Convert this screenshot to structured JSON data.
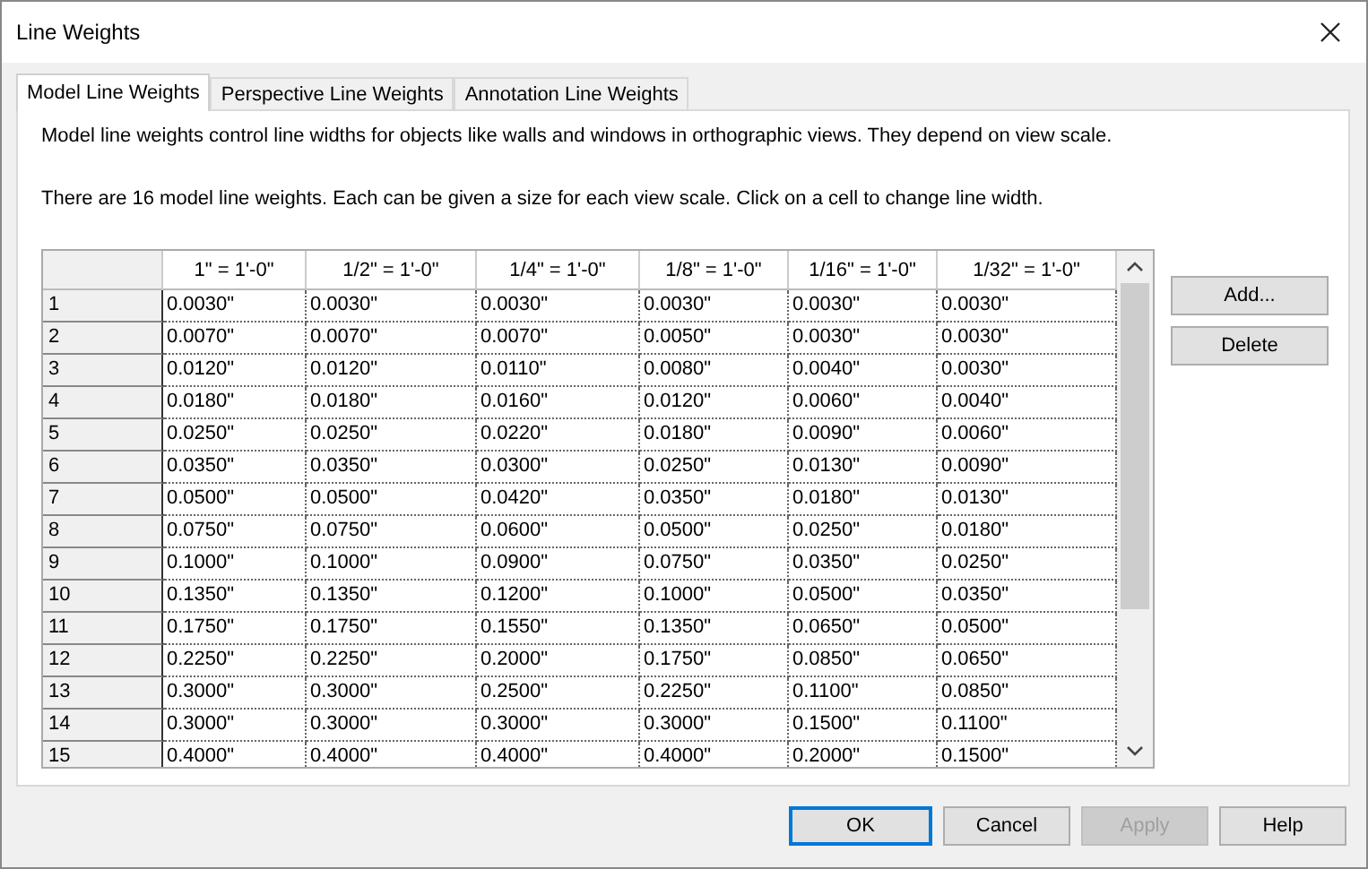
{
  "window": {
    "title": "Line Weights"
  },
  "tabs": [
    {
      "label": "Model Line Weights",
      "selected": true
    },
    {
      "label": "Perspective Line Weights",
      "selected": false
    },
    {
      "label": "Annotation Line Weights",
      "selected": false
    }
  ],
  "description": [
    "Model line weights control line widths for objects like walls and windows in orthographic views. They depend on view scale.",
    "There are 16 model line weights. Each can be given a size for each view scale. Click on a cell to change line width."
  ],
  "table": {
    "columns": [
      "1\" = 1'-0\"",
      "1/2\" = 1'-0\"",
      "1/4\" = 1'-0\"",
      "1/8\" = 1'-0\"",
      "1/16\" = 1'-0\"",
      "1/32\" = 1'-0\""
    ],
    "rows": [
      {
        "label": "1",
        "cells": [
          "0.0030\"",
          "0.0030\"",
          "0.0030\"",
          "0.0030\"",
          "0.0030\"",
          "0.0030\""
        ]
      },
      {
        "label": "2",
        "cells": [
          "0.0070\"",
          "0.0070\"",
          "0.0070\"",
          "0.0050\"",
          "0.0030\"",
          "0.0030\""
        ]
      },
      {
        "label": "3",
        "cells": [
          "0.0120\"",
          "0.0120\"",
          "0.0110\"",
          "0.0080\"",
          "0.0040\"",
          "0.0030\""
        ]
      },
      {
        "label": "4",
        "cells": [
          "0.0180\"",
          "0.0180\"",
          "0.0160\"",
          "0.0120\"",
          "0.0060\"",
          "0.0040\""
        ]
      },
      {
        "label": "5",
        "cells": [
          "0.0250\"",
          "0.0250\"",
          "0.0220\"",
          "0.0180\"",
          "0.0090\"",
          "0.0060\""
        ]
      },
      {
        "label": "6",
        "cells": [
          "0.0350\"",
          "0.0350\"",
          "0.0300\"",
          "0.0250\"",
          "0.0130\"",
          "0.0090\""
        ]
      },
      {
        "label": "7",
        "cells": [
          "0.0500\"",
          "0.0500\"",
          "0.0420\"",
          "0.0350\"",
          "0.0180\"",
          "0.0130\""
        ]
      },
      {
        "label": "8",
        "cells": [
          "0.0750\"",
          "0.0750\"",
          "0.0600\"",
          "0.0500\"",
          "0.0250\"",
          "0.0180\""
        ]
      },
      {
        "label": "9",
        "cells": [
          "0.1000\"",
          "0.1000\"",
          "0.0900\"",
          "0.0750\"",
          "0.0350\"",
          "0.0250\""
        ]
      },
      {
        "label": "10",
        "cells": [
          "0.1350\"",
          "0.1350\"",
          "0.1200\"",
          "0.1000\"",
          "0.0500\"",
          "0.0350\""
        ]
      },
      {
        "label": "11",
        "cells": [
          "0.1750\"",
          "0.1750\"",
          "0.1550\"",
          "0.1350\"",
          "0.0650\"",
          "0.0500\""
        ]
      },
      {
        "label": "12",
        "cells": [
          "0.2250\"",
          "0.2250\"",
          "0.2000\"",
          "0.1750\"",
          "0.0850\"",
          "0.0650\""
        ]
      },
      {
        "label": "13",
        "cells": [
          "0.3000\"",
          "0.3000\"",
          "0.2500\"",
          "0.2250\"",
          "0.1100\"",
          "0.0850\""
        ]
      },
      {
        "label": "14",
        "cells": [
          "0.3000\"",
          "0.3000\"",
          "0.3000\"",
          "0.3000\"",
          "0.1500\"",
          "0.1100\""
        ]
      },
      {
        "label": "15",
        "cells": [
          "0.4000\"",
          "0.4000\"",
          "0.4000\"",
          "0.4000\"",
          "0.2000\"",
          "0.1500\""
        ]
      }
    ]
  },
  "side_buttons": [
    {
      "label": "Add...",
      "disabled": false
    },
    {
      "label": "Delete",
      "disabled": false
    }
  ],
  "footer_buttons": [
    {
      "label": "OK",
      "default": true,
      "disabled": false
    },
    {
      "label": "Cancel",
      "default": false,
      "disabled": false
    },
    {
      "label": "Apply",
      "default": false,
      "disabled": true
    },
    {
      "label": "Help",
      "default": false,
      "disabled": false
    }
  ]
}
